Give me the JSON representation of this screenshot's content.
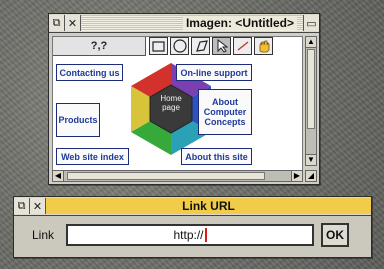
{
  "imagen": {
    "title": "Imagen: <Untitled>",
    "coordinate": "?,?",
    "tools": [
      {
        "icon": "rectangle-tool-icon"
      },
      {
        "icon": "ellipse-tool-icon"
      },
      {
        "icon": "polygon-tool-icon"
      },
      {
        "icon": "pointer-tool-icon"
      },
      {
        "icon": "line-tool-icon"
      },
      {
        "icon": "hand-tool-icon"
      }
    ],
    "hub_label_line1": "Home",
    "hub_label_line2": "page",
    "links": {
      "contacting": "Contacting us",
      "online_support": "On-line support",
      "products": "Products",
      "about_cc_line1": "About",
      "about_cc_line2": "Computer",
      "about_cc_line3": "Concepts",
      "site_index": "Web site index",
      "about_site": "About this site"
    },
    "hex_colors": [
      "#7a3fb0",
      "#2d53c2",
      "#2aa1b5",
      "#37a93a",
      "#d8c43a",
      "#d3322c"
    ]
  },
  "link_dialog": {
    "title": "Link URL",
    "label": "Link",
    "value": "http://",
    "ok_label": "OK"
  }
}
